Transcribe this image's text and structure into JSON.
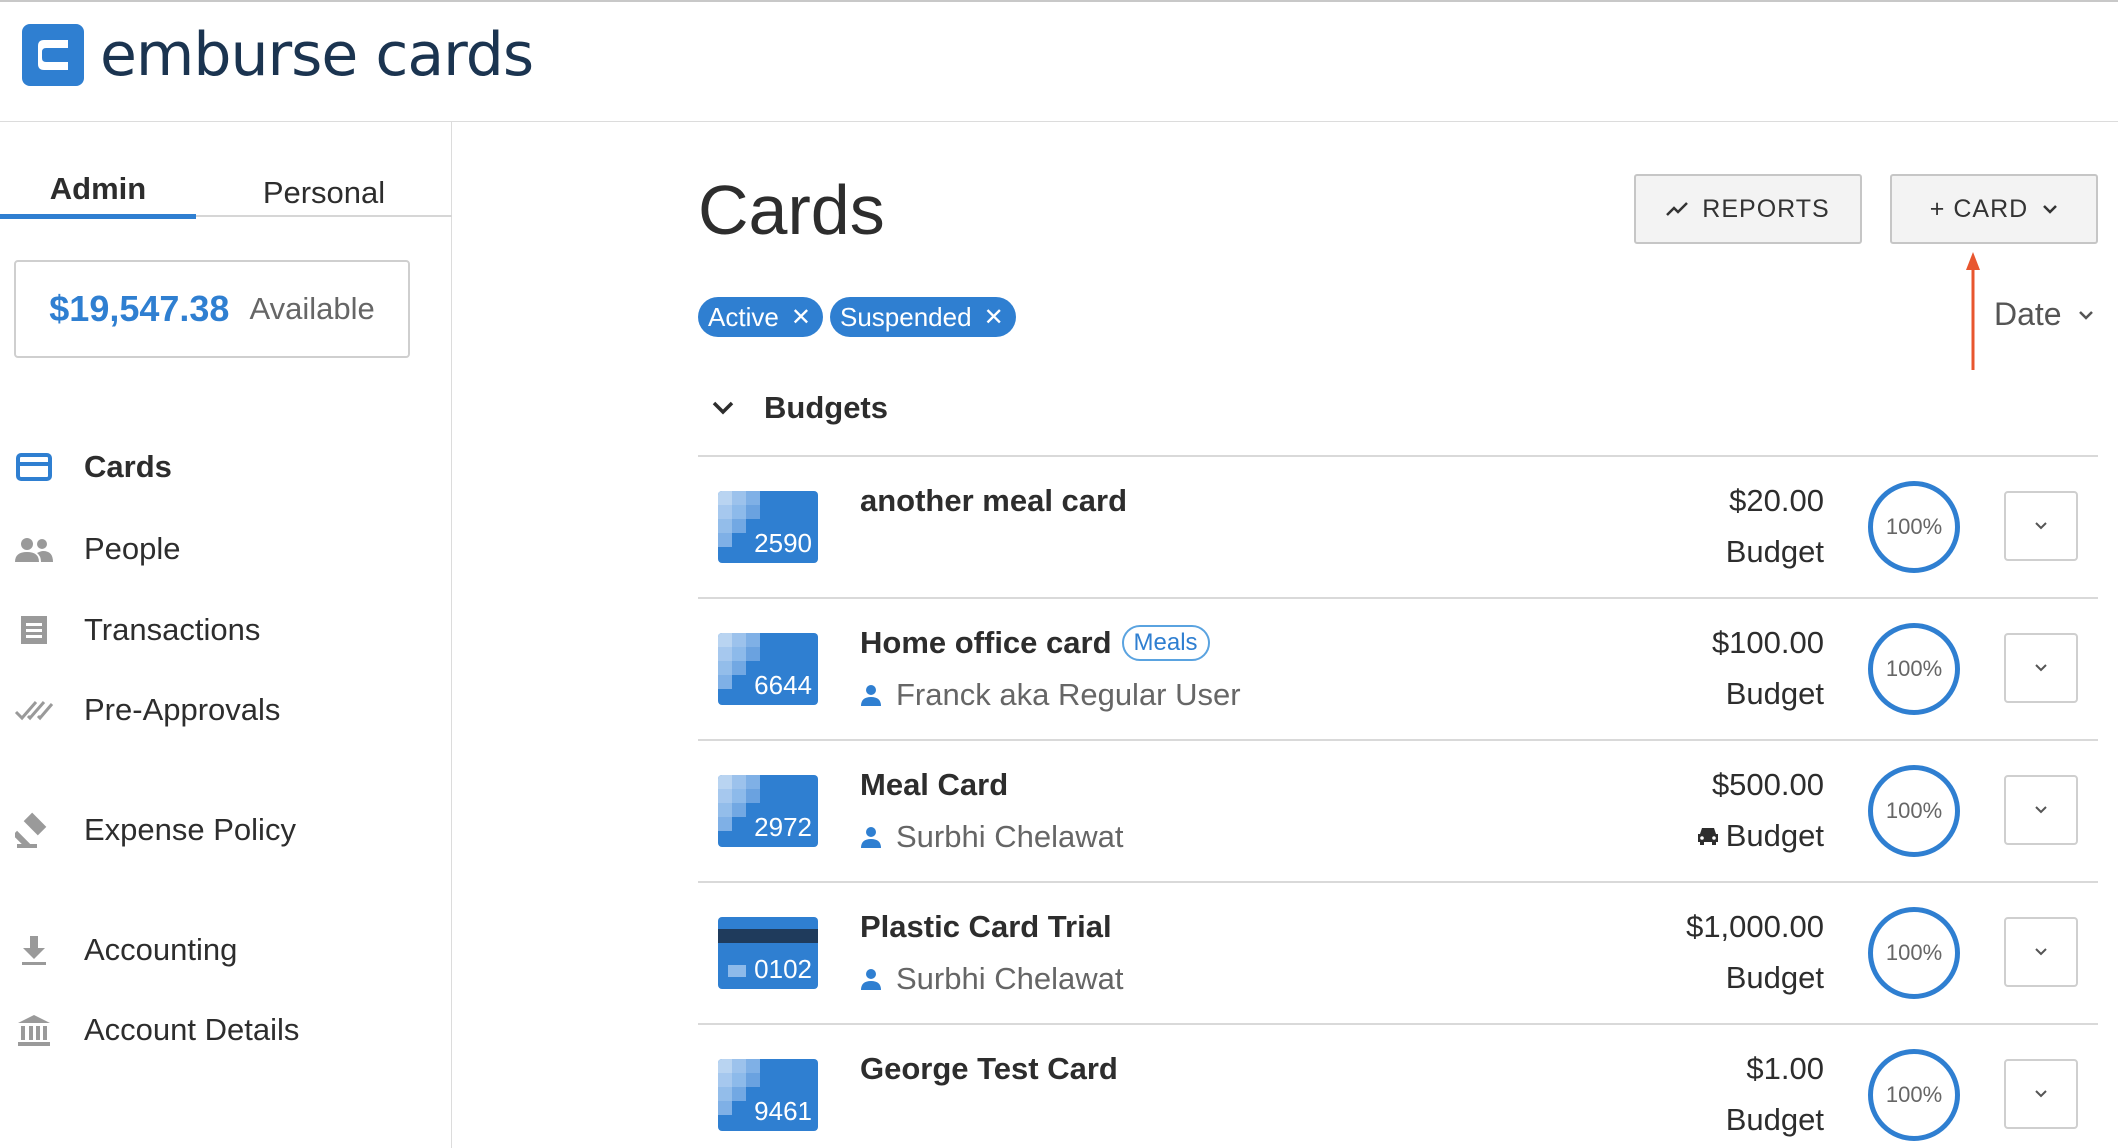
{
  "app": {
    "name": "emburse cards",
    "accent": "#2f7fd1"
  },
  "sidebar": {
    "tabs": [
      {
        "label": "Admin",
        "active": true
      },
      {
        "label": "Personal",
        "active": false
      }
    ],
    "balance": {
      "amount": "$19,547.38",
      "label": "Available"
    },
    "nav": [
      {
        "label": "Cards",
        "icon": "credit-card-icon",
        "active": true
      },
      {
        "label": "People",
        "icon": "people-icon"
      },
      {
        "label": "Transactions",
        "icon": "receipt-icon"
      },
      {
        "label": "Pre-Approvals",
        "icon": "double-check-icon"
      },
      {
        "label": "Expense Policy",
        "icon": "gavel-icon"
      },
      {
        "label": "Accounting",
        "icon": "download-icon"
      },
      {
        "label": "Account Details",
        "icon": "bank-icon"
      }
    ]
  },
  "main": {
    "title": "Cards",
    "reports_label": "REPORTS",
    "add_card_label": "+ CARD",
    "filters": [
      {
        "label": "Active"
      },
      {
        "label": "Suspended"
      }
    ],
    "sort_label": "Date",
    "section_label": "Budgets",
    "cards": [
      {
        "name": "another meal card",
        "number": "2590",
        "tag": "",
        "holder": "",
        "amount": "$20.00",
        "type": "Budget",
        "percent": "100%",
        "style": "pixel"
      },
      {
        "name": "Home office card",
        "number": "6644",
        "tag": "Meals",
        "holder": "Franck aka Regular User",
        "amount": "$100.00",
        "type": "Budget",
        "percent": "100%",
        "style": "pixel"
      },
      {
        "name": "Meal Card",
        "number": "2972",
        "tag": "",
        "holder": "Surbhi Chelawat",
        "amount": "$500.00",
        "type": "Budget",
        "percent": "100%",
        "style": "pixel",
        "car_icon": true
      },
      {
        "name": "Plastic Card Trial",
        "number": "0102",
        "tag": "",
        "holder": "Surbhi Chelawat",
        "amount": "$1,000.00",
        "type": "Budget",
        "percent": "100%",
        "style": "plastic"
      },
      {
        "name": "George Test Card",
        "number": "9461",
        "tag": "",
        "holder": "",
        "amount": "$1.00",
        "type": "Budget",
        "percent": "100%",
        "style": "pixel"
      }
    ]
  }
}
